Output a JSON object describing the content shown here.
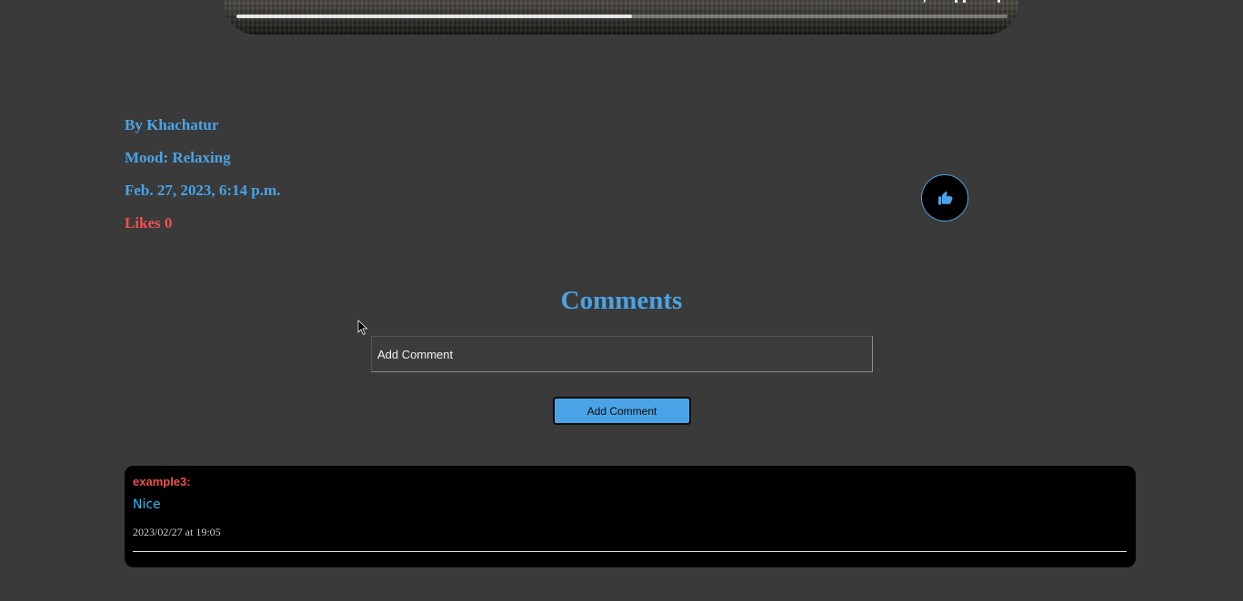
{
  "video": {
    "progress_fraction": 0.513
  },
  "post": {
    "author": "By Khachatur",
    "mood": "Mood: Relaxing",
    "date": "Feb. 27, 2023, 6:14 p.m.",
    "likes": "Likes 0"
  },
  "like_button": {
    "icon": "thumbs-up-icon",
    "icon_color": "#4aa3e6"
  },
  "comments": {
    "title": "Comments",
    "input_placeholder": "Add Comment",
    "submit_label": "Add Comment",
    "items": [
      {
        "author": "example3:",
        "text": "Nice",
        "date": "2023/02/27 at 19:05"
      }
    ]
  },
  "colors": {
    "background": "#3a3a3a",
    "accent": "#4aa3e6",
    "likes": "#f05050",
    "comment_text": "#35b8f0",
    "card": "#000000"
  }
}
